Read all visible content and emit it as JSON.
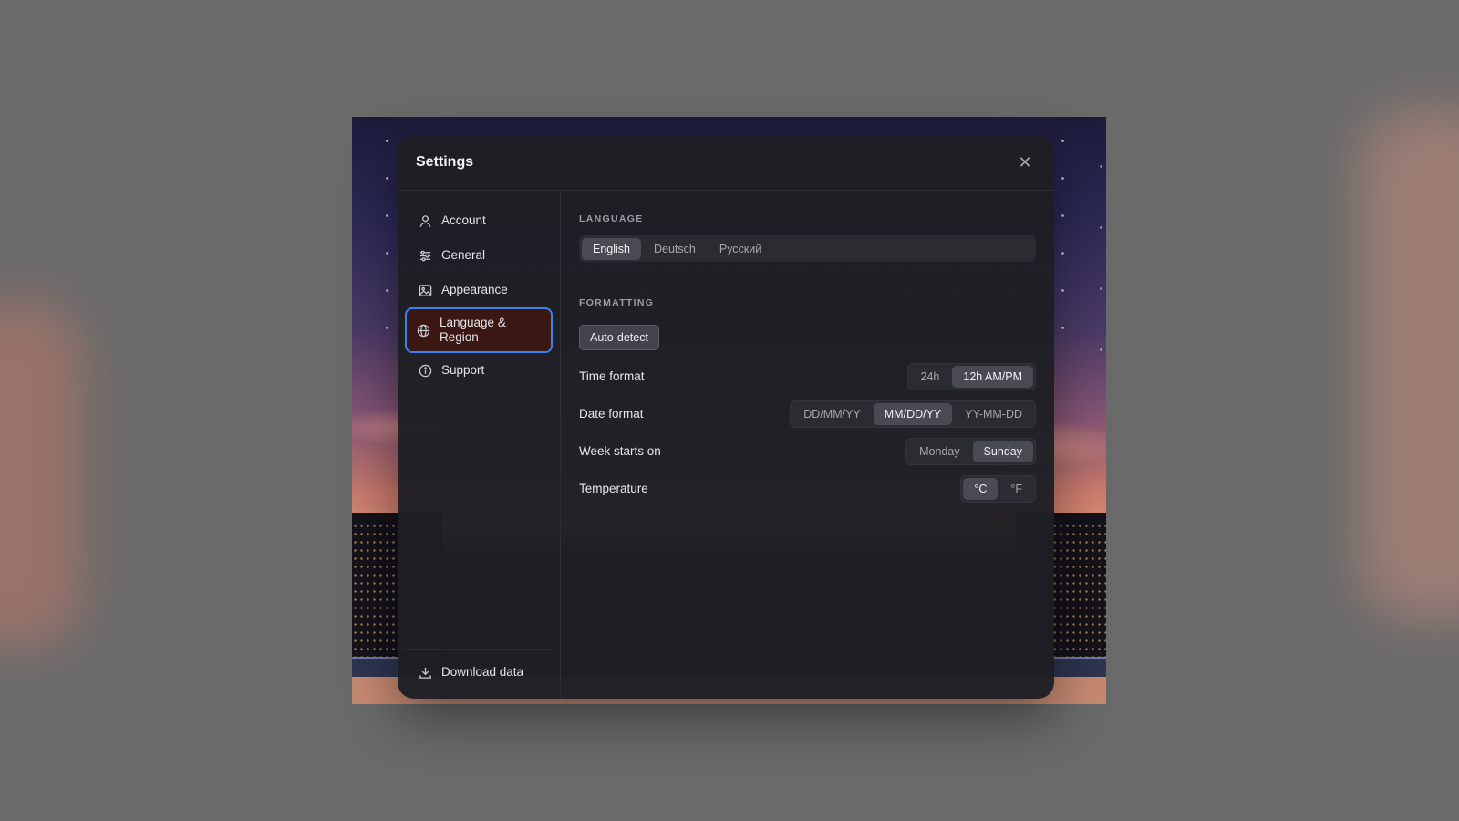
{
  "dialog": {
    "title": "Settings",
    "close_glyph": "✕"
  },
  "sidebar": {
    "items": [
      {
        "label": "Account",
        "icon": "user-icon"
      },
      {
        "label": "General",
        "icon": "sliders-icon"
      },
      {
        "label": "Appearance",
        "icon": "image-icon"
      },
      {
        "label": "Language & Region",
        "icon": "globe-icon",
        "active": true
      },
      {
        "label": "Support",
        "icon": "info-icon"
      }
    ],
    "footer": {
      "label": "Download data",
      "icon": "download-icon"
    }
  },
  "language": {
    "section_label": "LANGUAGE",
    "options": [
      "English",
      "Deutsch",
      "Русский"
    ],
    "selected": "English"
  },
  "formatting": {
    "section_label": "FORMATTING",
    "auto_detect_label": "Auto-detect",
    "time_format": {
      "label": "Time format",
      "options": [
        "24h",
        "12h AM/PM"
      ],
      "selected": "12h AM/PM"
    },
    "date_format": {
      "label": "Date format",
      "options": [
        "DD/MM/YY",
        "MM/DD/YY",
        "YY-MM-DD"
      ],
      "selected": "MM/DD/YY"
    },
    "week_starts_on": {
      "label": "Week starts on",
      "options": [
        "Monday",
        "Sunday"
      ],
      "selected": "Sunday"
    },
    "temperature": {
      "label": "Temperature",
      "options": [
        "°C",
        "°F"
      ],
      "selected": "°C"
    }
  },
  "colors": {
    "active_border": "#3a82f0",
    "active_bg": "#3b1713",
    "dialog_bg": "#1e1f24"
  }
}
